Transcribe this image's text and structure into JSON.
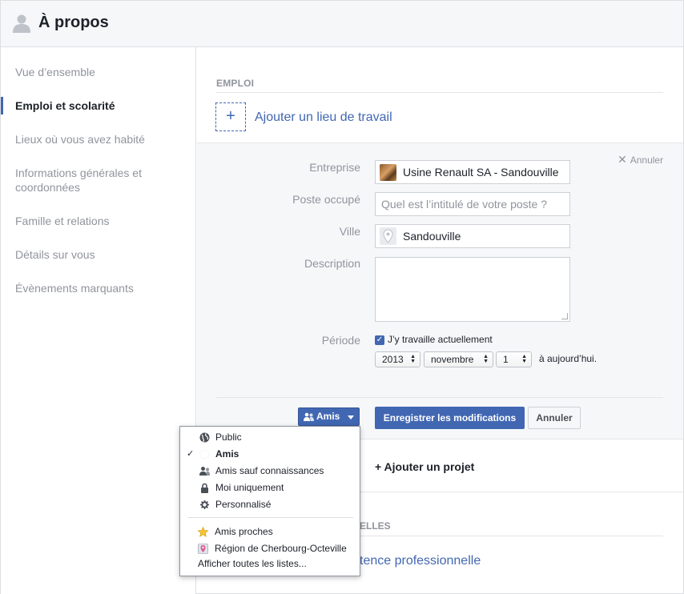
{
  "header": {
    "title": "À propos"
  },
  "sidebar": {
    "items": [
      {
        "label": "Vue d’ensemble"
      },
      {
        "label": "Emploi et scolarité"
      },
      {
        "label": "Lieux où vous avez habité"
      },
      {
        "label": "Informations générales et coordonnées"
      },
      {
        "label": "Famille et relations"
      },
      {
        "label": "Détails sur vous"
      },
      {
        "label": "Évènements marquants"
      }
    ]
  },
  "emploi": {
    "section_label": "EMPLOI",
    "add_plus": "+",
    "add_workplace": "Ajouter un lieu de travail",
    "cancel_label": "Annuler",
    "fields": {
      "company_label": "Entreprise",
      "company_value": "Usine Renault SA - Sandouville",
      "position_label": "Poste occupé",
      "position_placeholder": "Quel est l’intitulé de votre poste ?",
      "city_label": "Ville",
      "city_value": "Sandouville",
      "description_label": "Description",
      "period_label": "Période",
      "currently_working": "J’y travaille actuellement",
      "currently_working_checked": true,
      "year": "2013",
      "month": "novembre",
      "day": "1",
      "to_today": "à aujourd’hui."
    },
    "privacy_button": "Amis",
    "save_button": "Enregistrer les modifications",
    "cancel_button": "Annuler",
    "add_project": "+ Ajouter un projet"
  },
  "section2": {
    "label_fragment": "ELLES",
    "add_link_fragment": "tence professionnelle"
  },
  "privacy_menu": {
    "items": [
      {
        "label": "Public",
        "icon": "globe-icon",
        "selected": false
      },
      {
        "label": "Amis",
        "icon": "friends-icon",
        "selected": true
      },
      {
        "label": "Amis sauf connaissances",
        "icon": "friends-except-icon",
        "selected": false
      },
      {
        "label": "Moi uniquement",
        "icon": "lock-icon",
        "selected": false
      },
      {
        "label": "Personnalisé",
        "icon": "gear-icon",
        "selected": false
      }
    ],
    "lists": [
      {
        "label": "Amis proches",
        "icon": "star-icon"
      },
      {
        "label": "Région de Cherbourg-Octeville",
        "icon": "location-pin-icon"
      }
    ],
    "show_all": "Afficher toutes les listes...",
    "check_mark": "✓"
  },
  "colors": {
    "accent": "#4267b2",
    "muted_text": "#90949c",
    "panel_bg": "#f6f7f9"
  }
}
